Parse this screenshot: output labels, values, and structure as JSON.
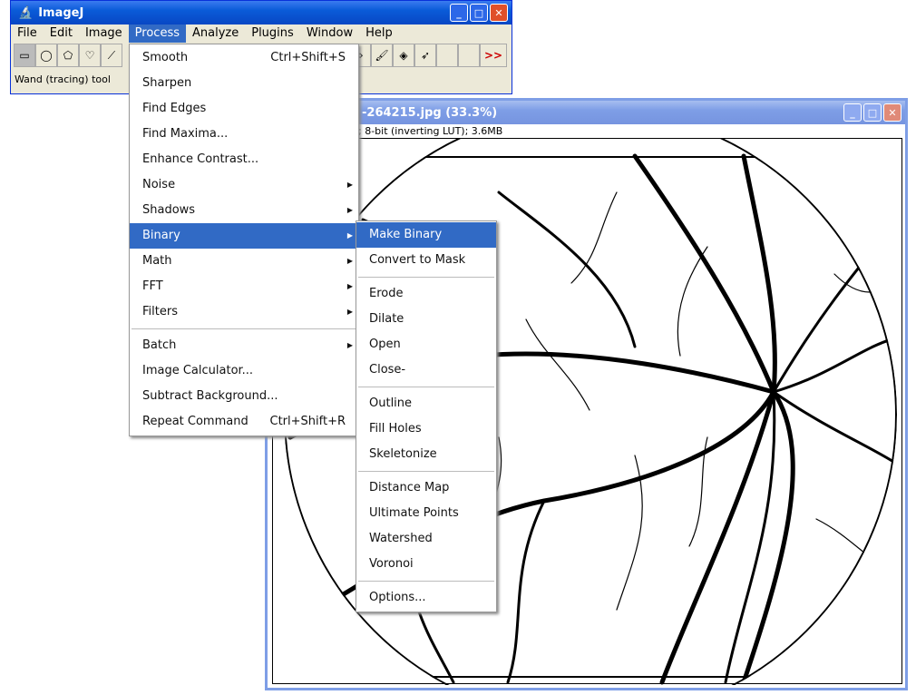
{
  "main_window": {
    "title": "ImageJ",
    "menus": [
      "File",
      "Edit",
      "Image",
      "Process",
      "Analyze",
      "Plugins",
      "Window",
      "Help"
    ],
    "active_menu": "Process",
    "status": "Wand (tracing) tool",
    "more_tools": ">>"
  },
  "image_window": {
    "title": "-264215.jpg (33.3%)",
    "info": "; 8-bit (inverting LUT); 3.6MB"
  },
  "process_menu": {
    "groups": [
      [
        {
          "label": "Smooth",
          "shortcut": "Ctrl+Shift+S"
        },
        {
          "label": "Sharpen"
        },
        {
          "label": "Find Edges"
        },
        {
          "label": "Find Maxima..."
        },
        {
          "label": "Enhance Contrast..."
        },
        {
          "label": "Noise",
          "submenu": true
        },
        {
          "label": "Shadows",
          "submenu": true
        },
        {
          "label": "Binary",
          "submenu": true,
          "highlighted": true
        },
        {
          "label": "Math",
          "submenu": true
        },
        {
          "label": "FFT",
          "submenu": true
        },
        {
          "label": "Filters",
          "submenu": true
        }
      ],
      [
        {
          "label": "Batch",
          "submenu": true
        },
        {
          "label": "Image Calculator..."
        },
        {
          "label": "Subtract Background..."
        },
        {
          "label": "Repeat Command",
          "shortcut": "Ctrl+Shift+R"
        }
      ]
    ]
  },
  "binary_menu": {
    "groups": [
      [
        {
          "label": "Make Binary",
          "highlighted": true
        },
        {
          "label": "Convert to Mask"
        }
      ],
      [
        {
          "label": "Erode"
        },
        {
          "label": "Dilate"
        },
        {
          "label": "Open"
        },
        {
          "label": "Close-"
        }
      ],
      [
        {
          "label": "Outline"
        },
        {
          "label": "Fill Holes"
        },
        {
          "label": "Skeletonize"
        }
      ],
      [
        {
          "label": "Distance Map"
        },
        {
          "label": "Ultimate Points"
        },
        {
          "label": "Watershed"
        },
        {
          "label": "Voronoi"
        }
      ],
      [
        {
          "label": "Options..."
        }
      ]
    ]
  },
  "colors": {
    "title_active": "#0a5bd8",
    "highlight": "#316ac5"
  }
}
